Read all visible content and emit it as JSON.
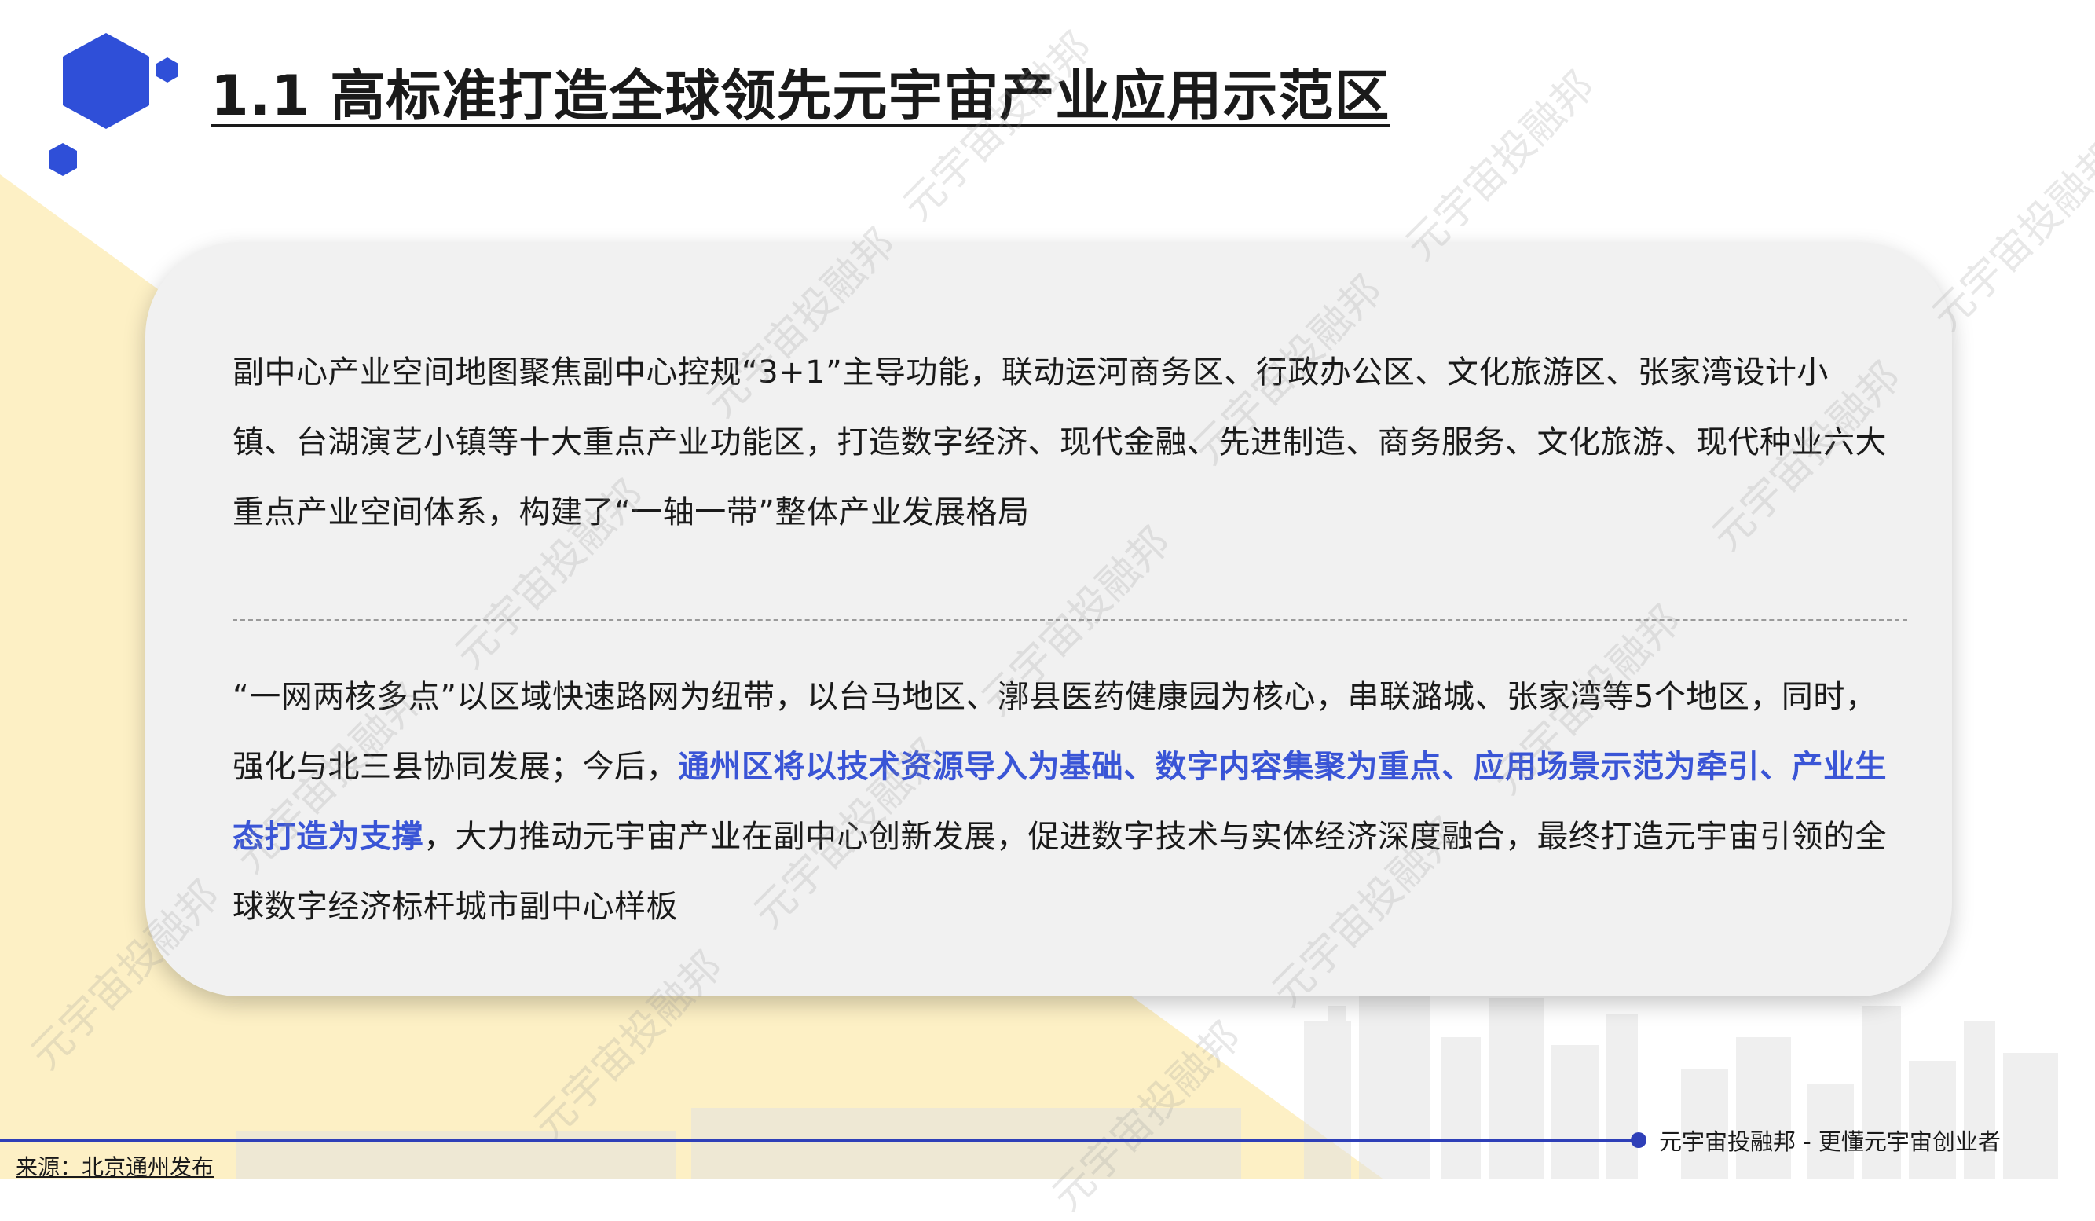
{
  "title": "1.1 高标准打造全球领先元宇宙产业应用示范区",
  "paragraph1": "副中心产业空间地图聚焦副中心控规“3+1”主导功能，联动运河商务区、行政办公区、文化旅游区、张家湾设计小镇、台湖演艺小镇等十大重点产业功能区，打造数字经济、现代金融、先进制造、商务服务、文化旅游、现代种业六大重点产业空间体系，构建了“一轴一带”整体产业发展格局",
  "paragraph2": {
    "before": "“一网两核多点”以区域快速路网为纽带，以台马地区、漷县医药健康园为核心，串联潞城、张家湾等5个地区，同时，强化与北三县协同发展；今后，",
    "highlight": "通州区将以技术资源导入为基础、数字内容集聚为重点、应用场景示范为牵引、产业生态打造为支撑",
    "after": "，大力推动元宇宙产业在副中心创新发展，促进数字技术与实体经济深度融合，最终打造元宇宙引领的全球数字经济标杆城市副中心样板"
  },
  "watermark_text": "元宇宙投融邦",
  "footer": {
    "brand": "元宇宙投融邦  - 更懂元宇宙创业者",
    "source": "来源：北京通州发布"
  },
  "colors": {
    "accent": "#3a55d6",
    "logo_blue": "#2f4fd8",
    "triangle_yellow": "#fdf0c5",
    "card_bg": "#f1f1f1",
    "footer_line": "#2e3fb8"
  }
}
